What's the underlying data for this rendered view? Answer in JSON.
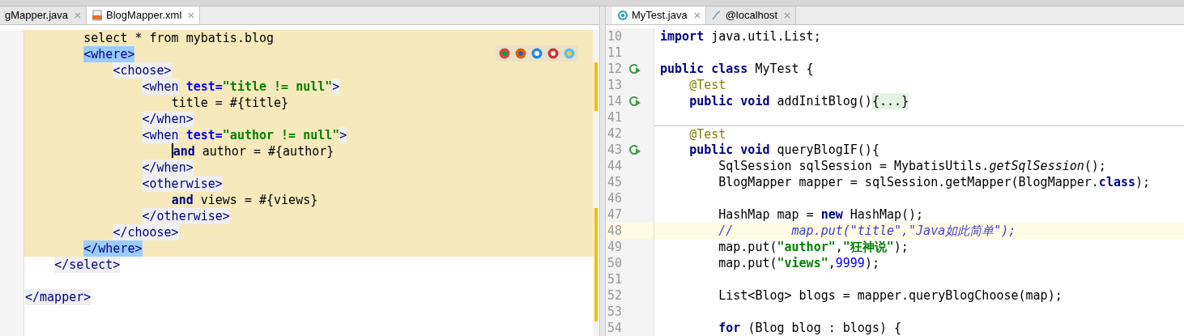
{
  "left": {
    "tabs": [
      {
        "label": "gMapper.java",
        "selected": false
      },
      {
        "label": "BlogMapper.xml",
        "selected": true
      }
    ],
    "lines": [
      {
        "selected": true,
        "segments": [
          {
            "kind": "plain",
            "text": "        select * from mybatis.blog"
          }
        ]
      },
      {
        "selected": true,
        "segments": [
          {
            "kind": "match",
            "text": "        <where>"
          }
        ]
      },
      {
        "selected": true,
        "segments": [
          {
            "kind": "tag",
            "text": "            <choose>"
          }
        ]
      },
      {
        "selected": true,
        "segments": [
          {
            "kind": "tag",
            "text": "                <when"
          },
          {
            "kind": "attr",
            "text": " test="
          },
          {
            "kind": "string",
            "text": "\"title != null\""
          },
          {
            "kind": "tag",
            "text": ">"
          }
        ]
      },
      {
        "selected": true,
        "segments": [
          {
            "kind": "plain",
            "text": "                    title = #{title}"
          }
        ]
      },
      {
        "selected": true,
        "segments": [
          {
            "kind": "tag",
            "text": "                </when>"
          }
        ]
      },
      {
        "selected": true,
        "segments": [
          {
            "kind": "tag",
            "text": "                <when"
          },
          {
            "kind": "attr",
            "text": " test="
          },
          {
            "kind": "string",
            "text": "\"author != null\""
          },
          {
            "kind": "tag",
            "text": ">"
          }
        ]
      },
      {
        "selected": true,
        "caret": true,
        "segments": [
          {
            "kind": "keyword",
            "text": "                    and"
          },
          {
            "kind": "plain",
            "text": " author = #{author}"
          }
        ]
      },
      {
        "selected": true,
        "segments": [
          {
            "kind": "tag",
            "text": "                </when>"
          }
        ]
      },
      {
        "selected": true,
        "segments": [
          {
            "kind": "tag",
            "text": "                <otherwise>"
          }
        ]
      },
      {
        "selected": true,
        "segments": [
          {
            "kind": "keyword",
            "text": "                    and"
          },
          {
            "kind": "plain",
            "text": " views = #{views}"
          }
        ]
      },
      {
        "selected": true,
        "segments": [
          {
            "kind": "tag",
            "text": "                </otherwise>"
          }
        ]
      },
      {
        "selected": true,
        "segments": [
          {
            "kind": "tag",
            "text": "            </choose>"
          }
        ]
      },
      {
        "selected": true,
        "segments": [
          {
            "kind": "match",
            "text": "        </where>"
          }
        ]
      },
      {
        "selected": false,
        "segments": [
          {
            "kind": "tag",
            "text": "    </select>"
          }
        ]
      },
      {
        "selected": false
      },
      {
        "selected": false,
        "segments": [
          {
            "kind": "tag",
            "text": "</mapper>"
          }
        ]
      }
    ]
  },
  "right": {
    "tabs": [
      {
        "label": "MyTest.java",
        "selected": true
      },
      {
        "label": "@localhost",
        "selected": false
      }
    ],
    "lines": [
      {
        "number": "10",
        "kind": "plain",
        "current": false,
        "separator": false,
        "segments": [
          {
            "kind": "keyword",
            "text": "import"
          },
          {
            "kind": "plain",
            "text": " java.util.List;"
          }
        ]
      },
      {
        "number": "11",
        "kind": "plain",
        "current": false,
        "separator": false
      },
      {
        "number": "12",
        "kind": "runnable",
        "current": false,
        "separator": false,
        "segments": [
          {
            "kind": "keyword",
            "text": "public class"
          },
          {
            "kind": "plain",
            "text": " MyTest {"
          }
        ]
      },
      {
        "number": "13",
        "kind": "plain",
        "current": false,
        "separator": false,
        "segments": [
          {
            "kind": "annotation",
            "text": "    @Test"
          }
        ]
      },
      {
        "number": "14",
        "kind": "runnable",
        "current": false,
        "separator": false,
        "segments": [
          {
            "kind": "keyword",
            "text": "    public void"
          },
          {
            "kind": "plain",
            "text": " addInitBlog()"
          },
          {
            "kind": "folded",
            "text": "{...}"
          }
        ]
      },
      {
        "number": "41",
        "kind": "plain",
        "current": false,
        "separator": false
      },
      {
        "number": "42",
        "kind": "plain",
        "current": false,
        "separator": true,
        "segments": [
          {
            "kind": "annotation",
            "text": "    @Test"
          }
        ]
      },
      {
        "number": "43",
        "kind": "runnable",
        "current": false,
        "separator": false,
        "segments": [
          {
            "kind": "keyword",
            "text": "    public void"
          },
          {
            "kind": "plain",
            "text": " queryBlogIF(){"
          }
        ]
      },
      {
        "number": "44",
        "kind": "plain",
        "current": false,
        "separator": false,
        "segments": [
          {
            "kind": "plain",
            "text": "        SqlSession sqlSession = MybatisUtils."
          },
          {
            "kind": "static",
            "text": "getSqlSession"
          },
          {
            "kind": "plain",
            "text": "();"
          }
        ]
      },
      {
        "number": "45",
        "kind": "plain",
        "current": false,
        "separator": false,
        "segments": [
          {
            "kind": "plain",
            "text": "        BlogMapper mapper = sqlSession.getMapper(BlogMapper."
          },
          {
            "kind": "keyword",
            "text": "class"
          },
          {
            "kind": "plain",
            "text": ");"
          }
        ]
      },
      {
        "number": "46",
        "kind": "plain",
        "current": false,
        "separator": false
      },
      {
        "number": "47",
        "kind": "plain",
        "current": false,
        "separator": false,
        "segments": [
          {
            "kind": "plain",
            "text": "        HashMap map = "
          },
          {
            "kind": "keyword",
            "text": "new"
          },
          {
            "kind": "plain",
            "text": " HashMap();"
          }
        ]
      },
      {
        "number": "48",
        "kind": "plain",
        "current": true,
        "separator": false,
        "segments": [
          {
            "kind": "comment",
            "text": "        //        map.put(\"title\",\"Java如此简单\");"
          }
        ]
      },
      {
        "number": "49",
        "kind": "plain",
        "current": false,
        "separator": false,
        "segments": [
          {
            "kind": "plain",
            "text": "        map.put("
          },
          {
            "kind": "string",
            "text": "\"author\""
          },
          {
            "kind": "plain",
            "text": ","
          },
          {
            "kind": "string",
            "text": "\"狂神说\""
          },
          {
            "kind": "plain",
            "text": ");"
          }
        ]
      },
      {
        "number": "50",
        "kind": "plain",
        "current": false,
        "separator": false,
        "segments": [
          {
            "kind": "plain",
            "text": "        map.put("
          },
          {
            "kind": "string",
            "text": "\"views\""
          },
          {
            "kind": "plain",
            "text": ","
          },
          {
            "kind": "number",
            "text": "9999"
          },
          {
            "kind": "plain",
            "text": ");"
          }
        ]
      },
      {
        "number": "51",
        "kind": "plain",
        "current": false,
        "separator": false
      },
      {
        "number": "52",
        "kind": "plain",
        "current": false,
        "separator": false,
        "segments": [
          {
            "kind": "plain",
            "text": "        List<Blog> blogs = mapper.queryBlogChoose(map);"
          }
        ]
      },
      {
        "number": "53",
        "kind": "plain",
        "current": false,
        "separator": false
      },
      {
        "number": "54",
        "kind": "plain",
        "current": false,
        "separator": false,
        "segments": [
          {
            "kind": "keyword",
            "text": "        for"
          },
          {
            "kind": "plain",
            "text": " (Blog blog : blogs) {"
          }
        ]
      }
    ]
  }
}
